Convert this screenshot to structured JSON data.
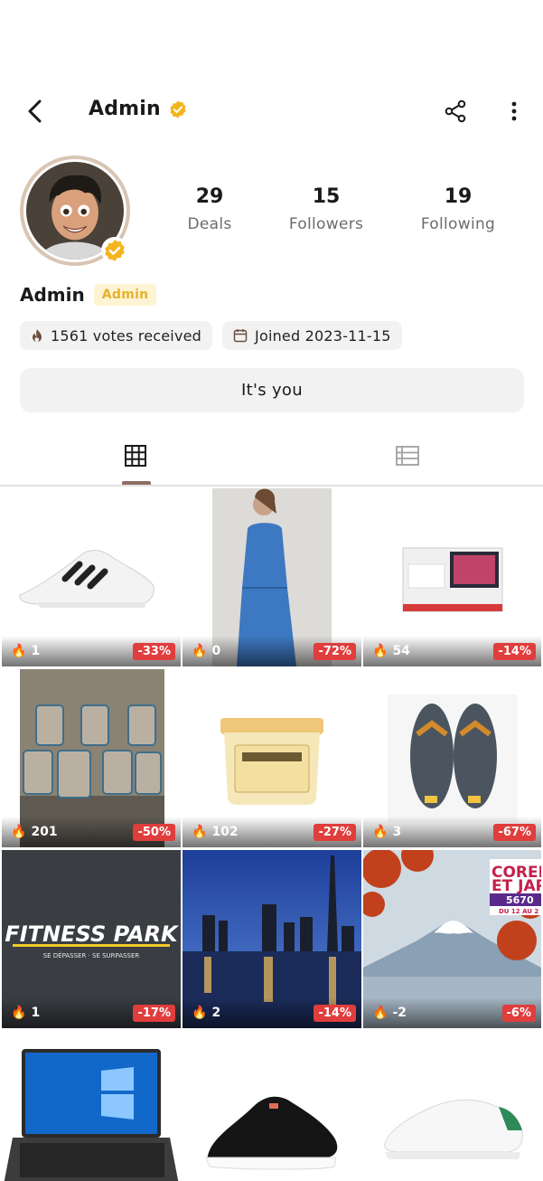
{
  "header": {
    "title": "Admin",
    "verified_color": "#f2b51d"
  },
  "profile": {
    "name": "Admin",
    "role_badge": "Admin",
    "stats": [
      {
        "value": "29",
        "label": "Deals"
      },
      {
        "value": "15",
        "label": "Followers"
      },
      {
        "value": "19",
        "label": "Following"
      }
    ],
    "votes_chip": "1561 votes received",
    "joined_chip": "Joined 2023-11-15",
    "action_button": "It's you"
  },
  "tabs": [
    {
      "icon": "grid-icon",
      "active": true
    },
    {
      "icon": "list-icon",
      "active": false
    }
  ],
  "deals": [
    {
      "image": "white-sneaker",
      "votes": "1",
      "discount": "-33%"
    },
    {
      "image": "blue-dress",
      "votes": "0",
      "discount": "-72%"
    },
    {
      "image": "tv-box",
      "votes": "54",
      "discount": "-14%"
    },
    {
      "image": "glass-cups",
      "votes": "201",
      "discount": "-50%"
    },
    {
      "image": "hair-mask-jar",
      "votes": "102",
      "discount": "-27%"
    },
    {
      "image": "flip-flops",
      "votes": "3",
      "discount": "-67%"
    },
    {
      "image": "fitness-park",
      "votes": "1",
      "discount": "-17%",
      "text_lines": [
        "FITNESS PARK",
        "SE DÉPASSER · SE SURPASSER"
      ]
    },
    {
      "image": "dubai-skyline",
      "votes": "2",
      "discount": "-14%"
    },
    {
      "image": "mount-fuji",
      "votes": "-2",
      "discount": "-6%",
      "text_lines": [
        "COREE",
        "ET JAP",
        "5670",
        "DU 12 AU 2"
      ]
    },
    {
      "image": "laptop",
      "votes": "",
      "discount": ""
    },
    {
      "image": "black-sneaker",
      "votes": "",
      "discount": ""
    },
    {
      "image": "white-sneaker-2",
      "votes": "",
      "discount": ""
    }
  ],
  "colors": {
    "accent_gold": "#f2b51d",
    "discount_red": "#e03d3d",
    "chip_bg": "#f2f2f2"
  }
}
